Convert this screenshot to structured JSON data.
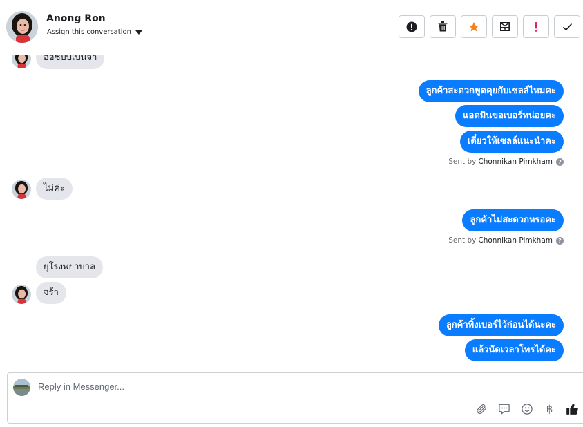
{
  "header": {
    "name": "Anong Ron",
    "assign_label": "Assign this conversation",
    "toolbar": [
      {
        "icon": "alert-circle-icon"
      },
      {
        "icon": "trash-icon"
      },
      {
        "icon": "star-icon",
        "color": "#f5821f"
      },
      {
        "icon": "move-inbox-icon"
      },
      {
        "icon": "exclamation-icon",
        "color": "#e0245e"
      },
      {
        "icon": "check-icon"
      }
    ]
  },
  "messages": [
    {
      "text": "ออชิบบเปนจา"
    },
    {
      "text": "ลูกค้าสะดวกพูดคุยกับเซลล์ไหมคะ"
    },
    {
      "text": "แอดมินขอเบอร์หน่อยคะ"
    },
    {
      "text": "เดี๋ยวให้เซลล์แนะนำคะ"
    },
    {
      "text": "ไม่ค่ะ"
    },
    {
      "text": "ลูกค้าไม่สะดวกหรอคะ"
    },
    {
      "text": "ยุโรงพยาบาล"
    },
    {
      "text": "จร้า"
    },
    {
      "text": "ลูกค้าทิ้งเบอร์ไว้ก่อนได้นะคะ"
    },
    {
      "text": "แล้วนัดเวลาโทรได้คะ"
    }
  ],
  "sent_by": {
    "prefix": "Sent by",
    "agent": "Chonnikan Pimkham"
  },
  "reply": {
    "placeholder": "Reply in Messenger...",
    "icons": [
      "paperclip-icon",
      "saved-reply-icon",
      "emoji-icon",
      "baht-icon",
      "thumbs-up-icon"
    ],
    "baht_symbol": "฿"
  }
}
